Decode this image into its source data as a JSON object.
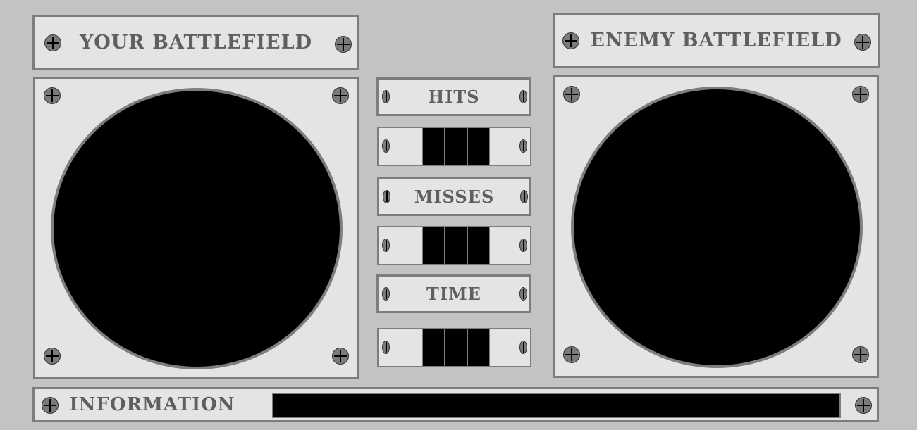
{
  "player": {
    "title": "YOUR BATTLEFIELD"
  },
  "enemy": {
    "title": "ENEMY BATTLEFIELD"
  },
  "scoreboard": {
    "hits_label": "HITS",
    "hits_digits": [
      "",
      "",
      ""
    ],
    "misses_label": "MISSES",
    "misses_digits": [
      "",
      "",
      ""
    ],
    "time_label": "TIME",
    "time_digits": [
      "",
      "",
      ""
    ]
  },
  "info": {
    "label": "INFORMATION",
    "message": ""
  },
  "icons": {
    "screw": "screw-icon"
  },
  "colors": {
    "background": "#c3c3c3",
    "panel": "#e4e4e4",
    "border": "#7d7d7d",
    "label_text": "#5f5f5f",
    "screen": "#000000"
  }
}
